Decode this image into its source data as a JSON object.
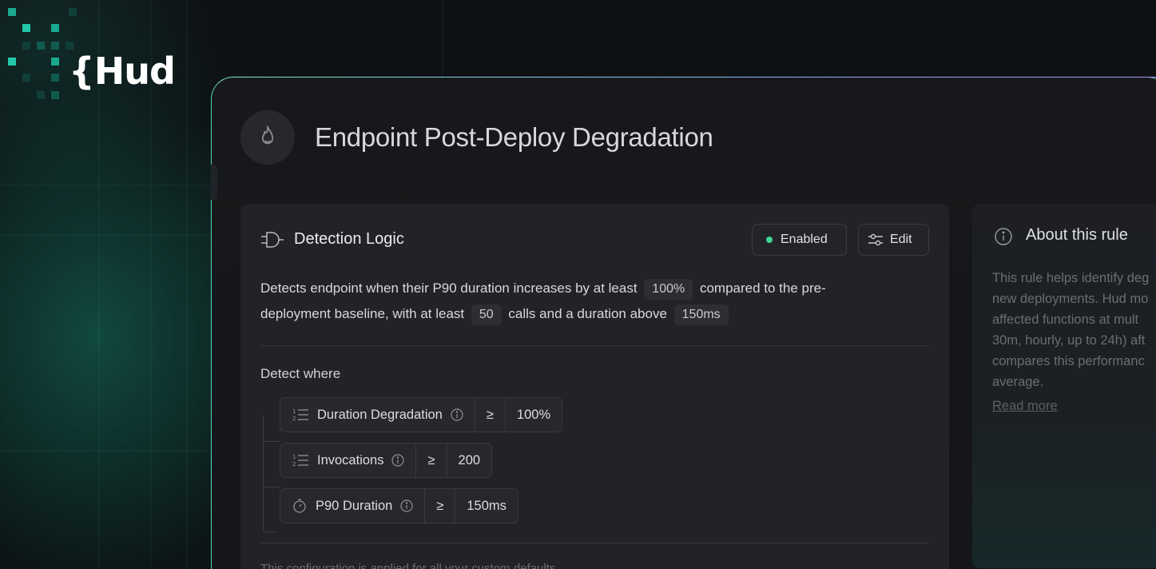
{
  "brand": {
    "logo_text": "{Hud",
    "accent": "#4fd1b8"
  },
  "page": {
    "title": "Endpoint Post-Deploy Degradation",
    "icon": "flame-icon"
  },
  "detection": {
    "title": "Detection Logic",
    "status_label": "Enabled",
    "status_color": "#3fd68f",
    "edit_label": "Edit",
    "description": {
      "p1": "Detects endpoint when their P90 duration increases by at least",
      "v1": "100%",
      "p2": "compared to the pre-",
      "p3": "deployment baseline, with at least",
      "v2": "50",
      "p4": "calls and a duration above",
      "v3": "150ms"
    },
    "detect_where_label": "Detect where",
    "conditions": [
      {
        "icon": "numbered-list-icon",
        "label": "Duration Degradation",
        "operator": "≥",
        "value": "100%"
      },
      {
        "icon": "numbered-list-icon",
        "label": "Invocations",
        "operator": "≥",
        "value": "200"
      },
      {
        "icon": "stopwatch-icon",
        "label": "P90 Duration",
        "operator": "≥",
        "value": "150ms"
      }
    ],
    "footnote": "This configuration is applied for all your custom defaults."
  },
  "about": {
    "title": "About this rule",
    "lines": [
      "This rule helps identify deg",
      "new deployments. Hud mo",
      "affected functions at mult",
      "30m, hourly, up to 24h) aft",
      "compares this performanc",
      "average."
    ],
    "read_more": "Read more"
  }
}
